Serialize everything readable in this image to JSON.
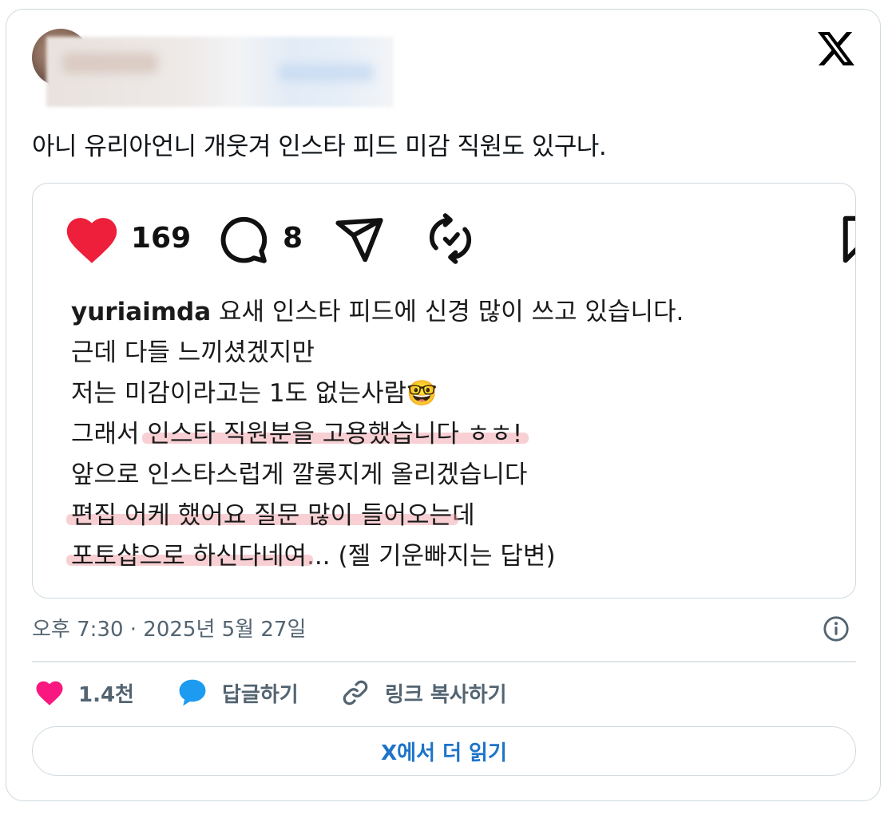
{
  "tweet": {
    "text": "아니 유리아언니 개웃겨 인스타 피드 미감 직원도 있구나.",
    "timestamp": "오후 7:30 · 2025년 5월 27일",
    "like_count": "1.4천",
    "reply_label": "답글하기",
    "copy_link_label": "링크 복사하기",
    "read_more_label": "X에서 더 읽기"
  },
  "instagram": {
    "like_count": "169",
    "comment_count": "8",
    "caption": {
      "username": "yuriaimda",
      "line1_rest": " 요새 인스타 피드에 신경 많이 쓰고 있습니다.",
      "line2": "근데 다들 느끼셨겠지만",
      "line3": "저는 미감이라고는 1도 없는사람",
      "line3_emoji": "🤓",
      "line4_plain": "그래서 ",
      "line4_highlight": "인스타 직원분을 고용했습니다 ㅎㅎ!",
      "line5": "앞으로 인스타스럽게 깔롱지게 올리겠습니다",
      "line6_highlight": "편집 어케 했어요 질문 많이 들어오는",
      "line6_plain": "데",
      "line7_highlight": "포토샵으로 하신다네여",
      "line7_plain": "... (젤 기운빠지는 답변)"
    }
  },
  "icons": {
    "brand": "x-logo-icon",
    "heart": "heart-icon",
    "comment": "comment-icon",
    "share": "send-icon",
    "repost": "repost-icon",
    "bookmark": "bookmark-icon",
    "info": "info-icon",
    "reply": "reply-bubble-icon",
    "link": "link-icon"
  },
  "colors": {
    "ig_heart": "#ed1f3a",
    "x_heart": "#f91880",
    "x_reply": "#1d9bf0",
    "read_more_text": "#1d74c9",
    "highlight": "#f096a0"
  }
}
